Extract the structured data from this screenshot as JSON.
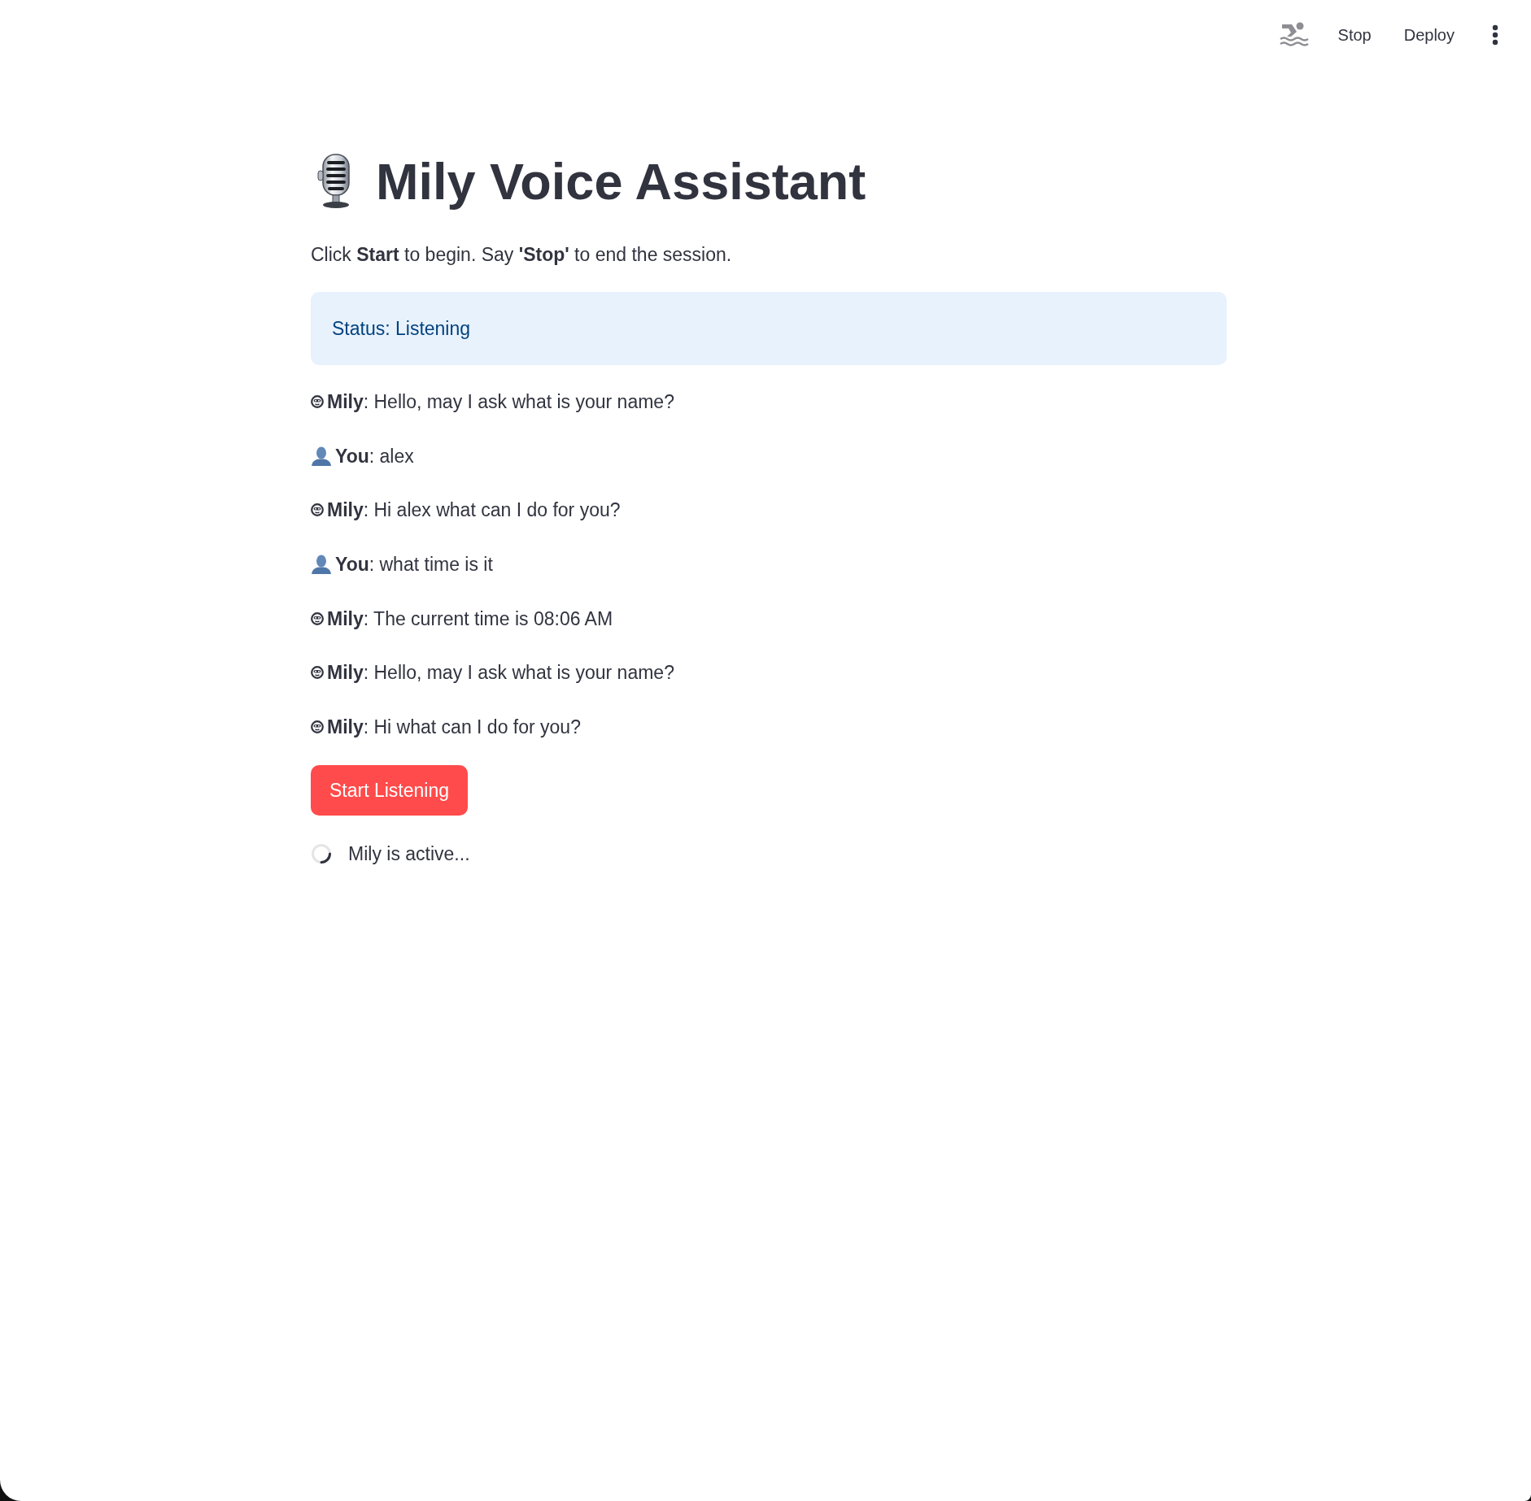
{
  "toolbar": {
    "buttons": [
      "Stop",
      "Deploy"
    ]
  },
  "title": "Mily Voice Assistant",
  "instructions": "Click **Start** to begin. Say **'Stop'** to end the session.",
  "status_box": {
    "kind": "info",
    "text": "Status: Listening"
  },
  "messages": [
    {
      "kind": "assistant",
      "text": "**Mily**: Hello, may I ask what is your name?"
    },
    {
      "kind": "user",
      "text": "**You**: alex"
    },
    {
      "kind": "assistant",
      "text": "**Mily**: Hi alex what can I do for you?"
    },
    {
      "kind": "user",
      "text": "**You**: what time is it"
    },
    {
      "kind": "assistant",
      "text": "**Mily**: The current time is 08:06 AM"
    },
    {
      "kind": "assistant",
      "text": "**Mily**: Hello, may I ask what is your name?"
    },
    {
      "kind": "assistant",
      "text": "**Mily**: Hi what can I do for you?"
    }
  ],
  "start_button": {
    "label": "Start Listening"
  },
  "spinner": {
    "text": "Mily is active..."
  }
}
